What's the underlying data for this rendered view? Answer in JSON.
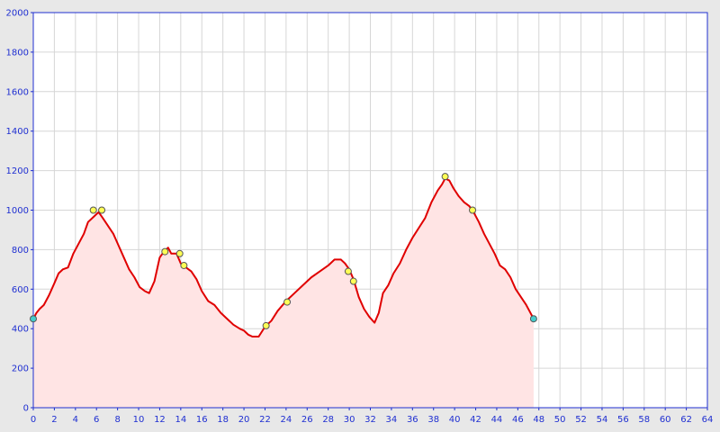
{
  "chart_data": {
    "type": "area",
    "title": "",
    "xlabel": "",
    "ylabel": "",
    "xlim": [
      0,
      64
    ],
    "ylim": [
      0,
      2000
    ],
    "x_ticks": [
      "0",
      "2",
      "4",
      "6",
      "8",
      "10",
      "12",
      "14",
      "16",
      "18",
      "20",
      "22",
      "24",
      "26",
      "28",
      "30",
      "32",
      "34",
      "36",
      "38",
      "40",
      "42",
      "44",
      "46",
      "48",
      "50",
      "52",
      "54",
      "56",
      "58",
      "60",
      "62",
      "64"
    ],
    "y_ticks": [
      "0",
      "200",
      "400",
      "600",
      "800",
      "1000",
      "1200",
      "1400",
      "1600",
      "1800",
      "2000"
    ],
    "grid": true,
    "colors": {
      "line": "#e00000",
      "fill": "#ffe4e4",
      "grid": "#d6d6d6",
      "axis": "#1f2fd1",
      "marker": "#ffff55",
      "endpoint_marker": "#44cccc",
      "plot_background": "#ffffff",
      "frame_background": "#e8e8e8"
    },
    "series": [
      {
        "values": [
          [
            0,
            450
          ],
          [
            0.3,
            480
          ],
          [
            0.6,
            500
          ],
          [
            1,
            520
          ],
          [
            1.5,
            570
          ],
          [
            2,
            630
          ],
          [
            2.4,
            680
          ],
          [
            2.8,
            700
          ],
          [
            3.3,
            710
          ],
          [
            3.8,
            780
          ],
          [
            4.3,
            830
          ],
          [
            4.8,
            880
          ],
          [
            5.2,
            940
          ],
          [
            5.8,
            970
          ],
          [
            6.2,
            990
          ],
          [
            6.6,
            960
          ],
          [
            7.1,
            920
          ],
          [
            7.6,
            880
          ],
          [
            8.1,
            820
          ],
          [
            8.6,
            760
          ],
          [
            9.1,
            700
          ],
          [
            9.6,
            660
          ],
          [
            10.1,
            610
          ],
          [
            10.6,
            590
          ],
          [
            11,
            580
          ],
          [
            11.5,
            640
          ],
          [
            12,
            760
          ],
          [
            12.4,
            790
          ],
          [
            12.8,
            810
          ],
          [
            13.1,
            780
          ],
          [
            13.6,
            780
          ],
          [
            14,
            730
          ],
          [
            14.5,
            710
          ],
          [
            15,
            690
          ],
          [
            15.5,
            650
          ],
          [
            16,
            590
          ],
          [
            16.6,
            540
          ],
          [
            17.2,
            520
          ],
          [
            17.8,
            480
          ],
          [
            18.4,
            450
          ],
          [
            19,
            420
          ],
          [
            19.6,
            400
          ],
          [
            20,
            390
          ],
          [
            20.4,
            370
          ],
          [
            20.8,
            360
          ],
          [
            21.4,
            360
          ],
          [
            22,
            410
          ],
          [
            22.6,
            440
          ],
          [
            23.2,
            490
          ],
          [
            24,
            540
          ],
          [
            24.8,
            580
          ],
          [
            25.6,
            620
          ],
          [
            26.4,
            660
          ],
          [
            27.2,
            690
          ],
          [
            28,
            720
          ],
          [
            28.6,
            750
          ],
          [
            29.2,
            750
          ],
          [
            29.6,
            730
          ],
          [
            30,
            700
          ],
          [
            30.4,
            650
          ],
          [
            30.9,
            560
          ],
          [
            31.4,
            500
          ],
          [
            31.9,
            460
          ],
          [
            32.4,
            430
          ],
          [
            32.8,
            480
          ],
          [
            33.2,
            580
          ],
          [
            33.7,
            620
          ],
          [
            34.2,
            680
          ],
          [
            34.8,
            730
          ],
          [
            35.4,
            800
          ],
          [
            36,
            860
          ],
          [
            36.6,
            910
          ],
          [
            37.2,
            960
          ],
          [
            37.8,
            1040
          ],
          [
            38.4,
            1100
          ],
          [
            38.8,
            1130
          ],
          [
            39.1,
            1160
          ],
          [
            39.5,
            1150
          ],
          [
            39.9,
            1110
          ],
          [
            40.4,
            1070
          ],
          [
            40.9,
            1040
          ],
          [
            41.4,
            1020
          ],
          [
            41.8,
            990
          ],
          [
            42.3,
            940
          ],
          [
            42.8,
            880
          ],
          [
            43.3,
            830
          ],
          [
            43.8,
            780
          ],
          [
            44.3,
            720
          ],
          [
            44.8,
            700
          ],
          [
            45.3,
            660
          ],
          [
            45.8,
            600
          ],
          [
            46.3,
            560
          ],
          [
            46.8,
            520
          ],
          [
            47.1,
            490
          ],
          [
            47.5,
            450
          ]
        ]
      }
    ],
    "markers": [
      {
        "x": 0,
        "y": 450,
        "kind": "endpoint"
      },
      {
        "x": 5.7,
        "y": 1000,
        "kind": "waypoint"
      },
      {
        "x": 6.5,
        "y": 1000,
        "kind": "waypoint"
      },
      {
        "x": 12.5,
        "y": 790,
        "kind": "waypoint"
      },
      {
        "x": 13.9,
        "y": 780,
        "kind": "waypoint"
      },
      {
        "x": 14.3,
        "y": 720,
        "kind": "waypoint"
      },
      {
        "x": 22.1,
        "y": 415,
        "kind": "waypoint"
      },
      {
        "x": 24.1,
        "y": 535,
        "kind": "waypoint"
      },
      {
        "x": 29.9,
        "y": 690,
        "kind": "waypoint"
      },
      {
        "x": 30.4,
        "y": 640,
        "kind": "waypoint"
      },
      {
        "x": 39.1,
        "y": 1170,
        "kind": "waypoint"
      },
      {
        "x": 41.7,
        "y": 1000,
        "kind": "waypoint"
      },
      {
        "x": 47.5,
        "y": 450,
        "kind": "endpoint"
      }
    ]
  }
}
